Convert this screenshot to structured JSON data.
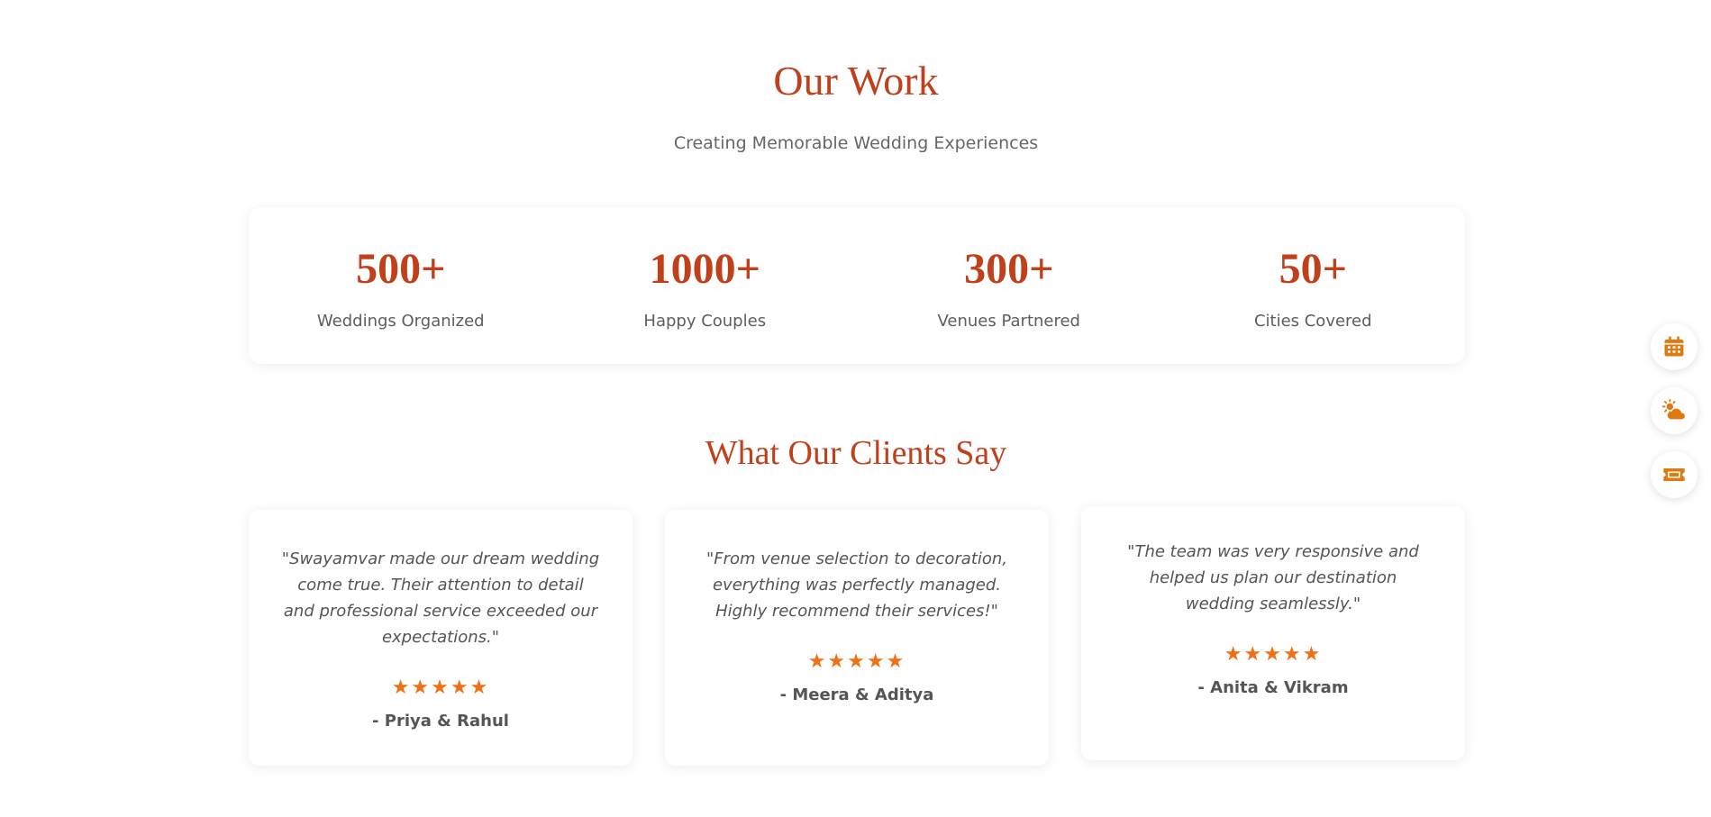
{
  "our_work": {
    "title": "Our Work",
    "subtitle": "Creating Memorable Wedding Experiences",
    "stats": [
      {
        "number": "500+",
        "label": "Weddings Organized"
      },
      {
        "number": "1000+",
        "label": "Happy Couples"
      },
      {
        "number": "300+",
        "label": "Venues Partnered"
      },
      {
        "number": "50+",
        "label": "Cities Covered"
      }
    ]
  },
  "testimonials": {
    "title": "What Our Clients Say",
    "items": [
      {
        "quote": "\"Swayamvar made our dream wedding come true. Their attention to detail and professional service exceeded our expectations.\"",
        "stars": "★★★★★",
        "rating": 5,
        "author": "- Priya & Rahul"
      },
      {
        "quote": "\"From venue selection to decoration, everything was perfectly managed. Highly recommend their services!\"",
        "stars": "★★★★★",
        "rating": 5,
        "author": "- Meera & Aditya"
      },
      {
        "quote": "\"The team was very responsive and helped us plan our destination wedding seamlessly.\"",
        "stars": "★★★★★",
        "rating": 5,
        "author": "- Anita & Vikram"
      }
    ]
  },
  "floating_actions": [
    {
      "icon": "calendar-icon"
    },
    {
      "icon": "weather-icon"
    },
    {
      "icon": "ticket-icon"
    }
  ],
  "colors": {
    "accent": "#c0401c",
    "star": "#f07015",
    "icon": "#e07a10"
  }
}
